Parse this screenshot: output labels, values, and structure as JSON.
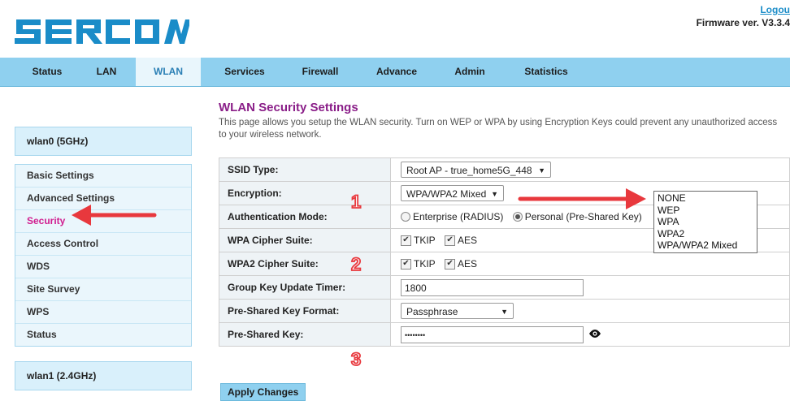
{
  "header": {
    "logo_text": "SERCOMM",
    "logout_label": "Logou",
    "firmware": "Firmware ver. V3.3.4"
  },
  "nav": {
    "items": [
      "Status",
      "LAN",
      "WLAN",
      "Services",
      "Firewall",
      "Advance",
      "Admin",
      "Statistics"
    ],
    "active": "WLAN"
  },
  "sidebar": {
    "group1": "wlan0 (5GHz)",
    "items": [
      "Basic Settings",
      "Advanced Settings",
      "Security",
      "Access Control",
      "WDS",
      "Site Survey",
      "WPS",
      "Status"
    ],
    "active": "Security",
    "group2": "wlan1 (2.4GHz)"
  },
  "main": {
    "title": "WLAN Security Settings",
    "description": "This page allows you setup the WLAN security. Turn on WEP or WPA by using Encryption Keys could prevent any unauthorized access to your wireless network."
  },
  "settings": {
    "ssid_type_label": "SSID Type:",
    "ssid_type_value": "Root AP - true_home5G_448",
    "encryption_label": "Encryption:",
    "encryption_value": "WPA/WPA2 Mixed",
    "auth_mode_label": "Authentication Mode:",
    "auth_enterprise": "Enterprise (RADIUS)",
    "auth_personal": "Personal (Pre-Shared Key)",
    "auth_selected": "Personal (Pre-Shared Key)",
    "wpa_cipher_label": "WPA Cipher Suite:",
    "wpa2_cipher_label": "WPA2 Cipher Suite:",
    "cipher_tkip": "TKIP",
    "cipher_aes": "AES",
    "group_key_label": "Group Key Update Timer:",
    "group_key_value": "1800",
    "psk_format_label": "Pre-Shared Key Format:",
    "psk_format_value": "Passphrase",
    "psk_label": "Pre-Shared Key:",
    "psk_value": "••••••••"
  },
  "encryption_options": [
    "NONE",
    "WEP",
    "WPA",
    "WPA2",
    "WPA/WPA2 Mixed"
  ],
  "apply_label": "Apply Changes",
  "annotations": [
    "1",
    "2",
    "3"
  ],
  "colors": {
    "nav_bg": "#8fd0ef",
    "brand_blue": "#1a8cc8",
    "title_purple": "#8a1e88",
    "active_pink": "#d11d8f",
    "arrow_red": "#e8383d"
  }
}
